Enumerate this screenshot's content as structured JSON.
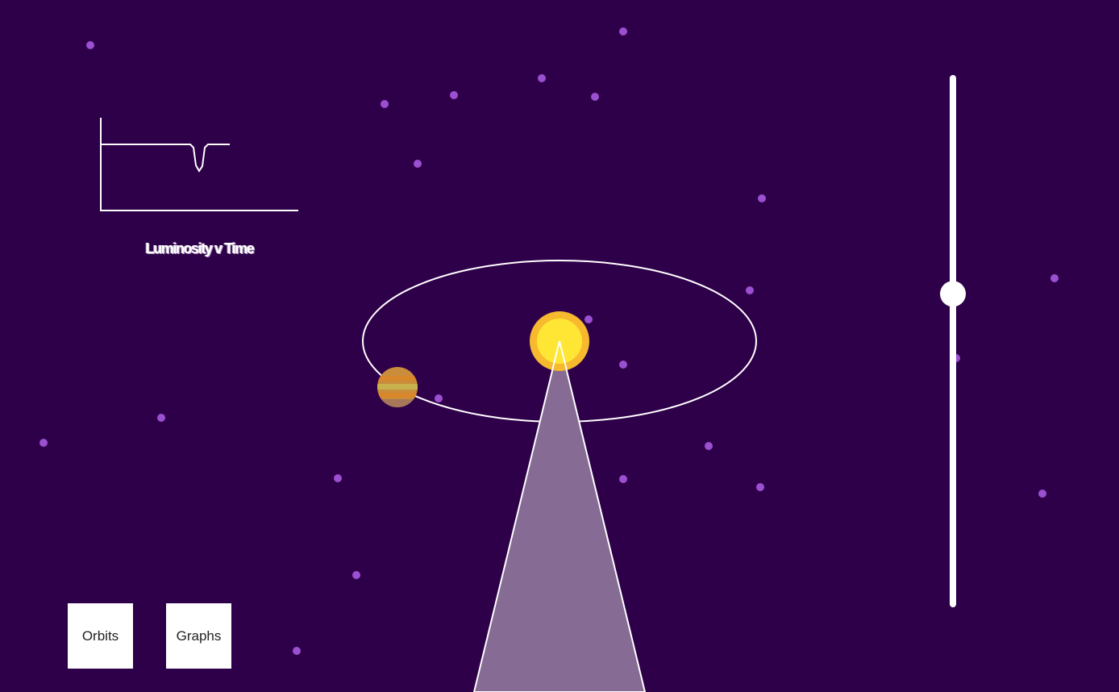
{
  "graph": {
    "caption": "Luminosity v Time"
  },
  "controls": {
    "orbits_label": "Orbits",
    "graphs_label": "Graphs"
  },
  "slider": {
    "value": 0.41
  },
  "colors": {
    "background": "#2f004a",
    "star_dot": "#9b4fd1",
    "sun_outer": "#f7b92e",
    "sun_inner": "#ffe534",
    "planet": "#c98d3c",
    "light_cone": "#866b95",
    "lines": "#ffffff"
  },
  "icons": {
    "sun": "sun-icon",
    "planet": "planet-icon"
  }
}
